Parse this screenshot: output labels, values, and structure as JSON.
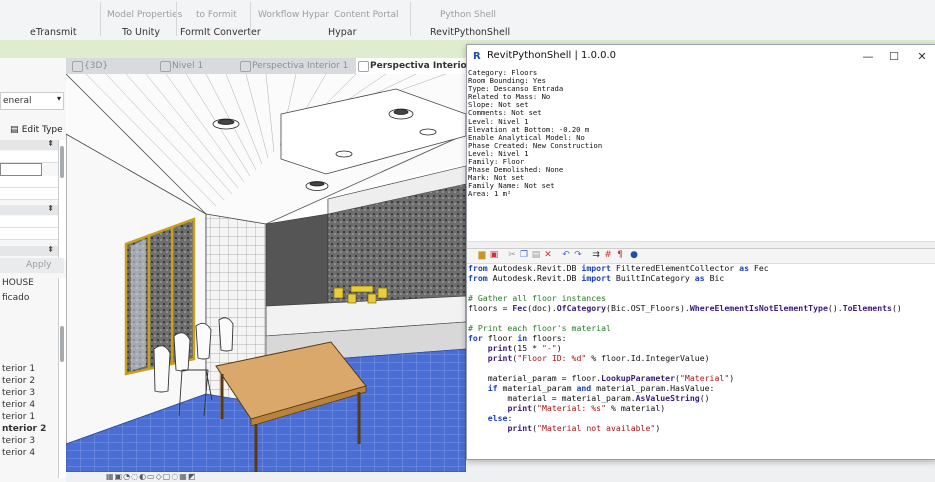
{
  "ribbon": {
    "items": [
      "eTransmit",
      "Model Properties",
      "To Unity",
      "to Formit",
      "Formit Converter",
      "Workflow",
      "Hypar",
      "Content Portal",
      "Hypar",
      "Python Shell",
      "RevitPythonShell"
    ],
    "top_row": {
      "model_properties": "Model Properties",
      "to_formit": "to Formit",
      "workflow": "Workflow",
      "hypar": "Hypar",
      "content_portal": "Content Portal",
      "python_shell": "Python Shell"
    },
    "bottom_row": {
      "etransmit": "eTransmit",
      "to_unity": "To Unity",
      "formit_converter": "FormIt Converter",
      "hypar": "Hypar",
      "revitpythonshell": "RevitPythonShell"
    }
  },
  "view_tabs": [
    {
      "label": "{3D}"
    },
    {
      "label": "Nivel 1"
    },
    {
      "label": "Perspectiva Interior 1"
    },
    {
      "label": "Perspectiva Interior"
    }
  ],
  "left_panel": {
    "type_selector": "eneral",
    "edit_type": "Edit Type",
    "apply": "Apply",
    "browser_root": "HOUSE",
    "browser_sub": "ficado",
    "views": [
      "terior 1",
      "terior 2",
      "terior 3",
      "terior 4",
      "terior 1",
      "nterior 2",
      "terior 3",
      "terior 4"
    ],
    "active_view_index": 5
  },
  "shell": {
    "title": "RevitPythonShell | 1.0.0.0",
    "controls": {
      "minimize": "—",
      "maximize": "☐",
      "close": "✕"
    },
    "output_lines": [
      "Category: Floors",
      "Room Bounding: Yes",
      "Type: Descanso Entrada",
      "Related to Mass: No",
      "Slope: Not set",
      "Comments: Not set",
      "Level: Nivel 1",
      "Elevation at Bottom: -0.20 m",
      "Enable Analytical Model: No",
      "Phase Created: New Construction",
      "Level: Nivel 1",
      "Family: Floor",
      "Phase Demolished: None",
      "Mark: Not set",
      "Family Name: Not set",
      "Area: 1 m²"
    ],
    "code_lines": [
      [
        [
          "kw",
          "from"
        ],
        [
          "t",
          " Autodesk.Revit.DB "
        ],
        [
          "kw",
          "import"
        ],
        [
          "t",
          " FilteredElementCollector "
        ],
        [
          "kw",
          "as"
        ],
        [
          "t",
          " Fec"
        ]
      ],
      [
        [
          "kw",
          "from"
        ],
        [
          "t",
          " Autodesk.Revit.DB "
        ],
        [
          "kw",
          "import"
        ],
        [
          "t",
          " BuiltInCategory "
        ],
        [
          "kw",
          "as"
        ],
        [
          "t",
          " Bic"
        ]
      ],
      [
        [
          "t",
          ""
        ]
      ],
      [
        [
          "cm",
          "# Gather all floor instances"
        ]
      ],
      [
        [
          "t",
          "floors = "
        ],
        [
          "fn",
          "Fec"
        ],
        [
          "t",
          "(doc)."
        ],
        [
          "fn",
          "OfCategory"
        ],
        [
          "t",
          "(Bic.OST_Floors)."
        ],
        [
          "fn",
          "WhereElementIsNotElementType"
        ],
        [
          "t",
          "()."
        ],
        [
          "fn",
          "ToElements"
        ],
        [
          "t",
          "()"
        ]
      ],
      [
        [
          "t",
          ""
        ]
      ],
      [
        [
          "cm",
          "# Print each floor's material"
        ]
      ],
      [
        [
          "kw",
          "for"
        ],
        [
          "t",
          " floor "
        ],
        [
          "kw",
          "in"
        ],
        [
          "t",
          " floors:"
        ]
      ],
      [
        [
          "t",
          "    "
        ],
        [
          "fn",
          "print"
        ],
        [
          "t",
          "(15 * "
        ],
        [
          "st",
          "\"-\""
        ],
        [
          "t",
          ")"
        ]
      ],
      [
        [
          "t",
          "    "
        ],
        [
          "fn",
          "print"
        ],
        [
          "t",
          "("
        ],
        [
          "st",
          "\"Floor ID: %d\""
        ],
        [
          "t",
          " % floor.Id.IntegerValue)"
        ]
      ],
      [
        [
          "t",
          ""
        ]
      ],
      [
        [
          "t",
          "    material_param = floor."
        ],
        [
          "fn",
          "LookupParameter"
        ],
        [
          "t",
          "("
        ],
        [
          "st",
          "\"Material\""
        ],
        [
          "t",
          ")"
        ]
      ],
      [
        [
          "t",
          "    "
        ],
        [
          "kw",
          "if"
        ],
        [
          "t",
          " material_param "
        ],
        [
          "kw",
          "and"
        ],
        [
          "t",
          " material_param.HasValue:"
        ]
      ],
      [
        [
          "t",
          "        material = material_param."
        ],
        [
          "fn",
          "AsValueString"
        ],
        [
          "t",
          "()"
        ]
      ],
      [
        [
          "t",
          "        "
        ],
        [
          "fn",
          "print"
        ],
        [
          "t",
          "("
        ],
        [
          "st",
          "\"Material: %s\""
        ],
        [
          "t",
          " % material)"
        ]
      ],
      [
        [
          "t",
          "    "
        ],
        [
          "kw",
          "else"
        ],
        [
          "t",
          ":"
        ]
      ],
      [
        [
          "t",
          "        "
        ],
        [
          "fn",
          "print"
        ],
        [
          "t",
          "("
        ],
        [
          "st",
          "\"Material not available\""
        ],
        [
          "t",
          ")"
        ]
      ]
    ]
  },
  "colors": {
    "accent": "#1f4fa8",
    "floor_blue": "#3f63c9",
    "table_wood": "#d9a86a",
    "window_frame": "#c8a020",
    "green_bar": "#dfeccf"
  }
}
